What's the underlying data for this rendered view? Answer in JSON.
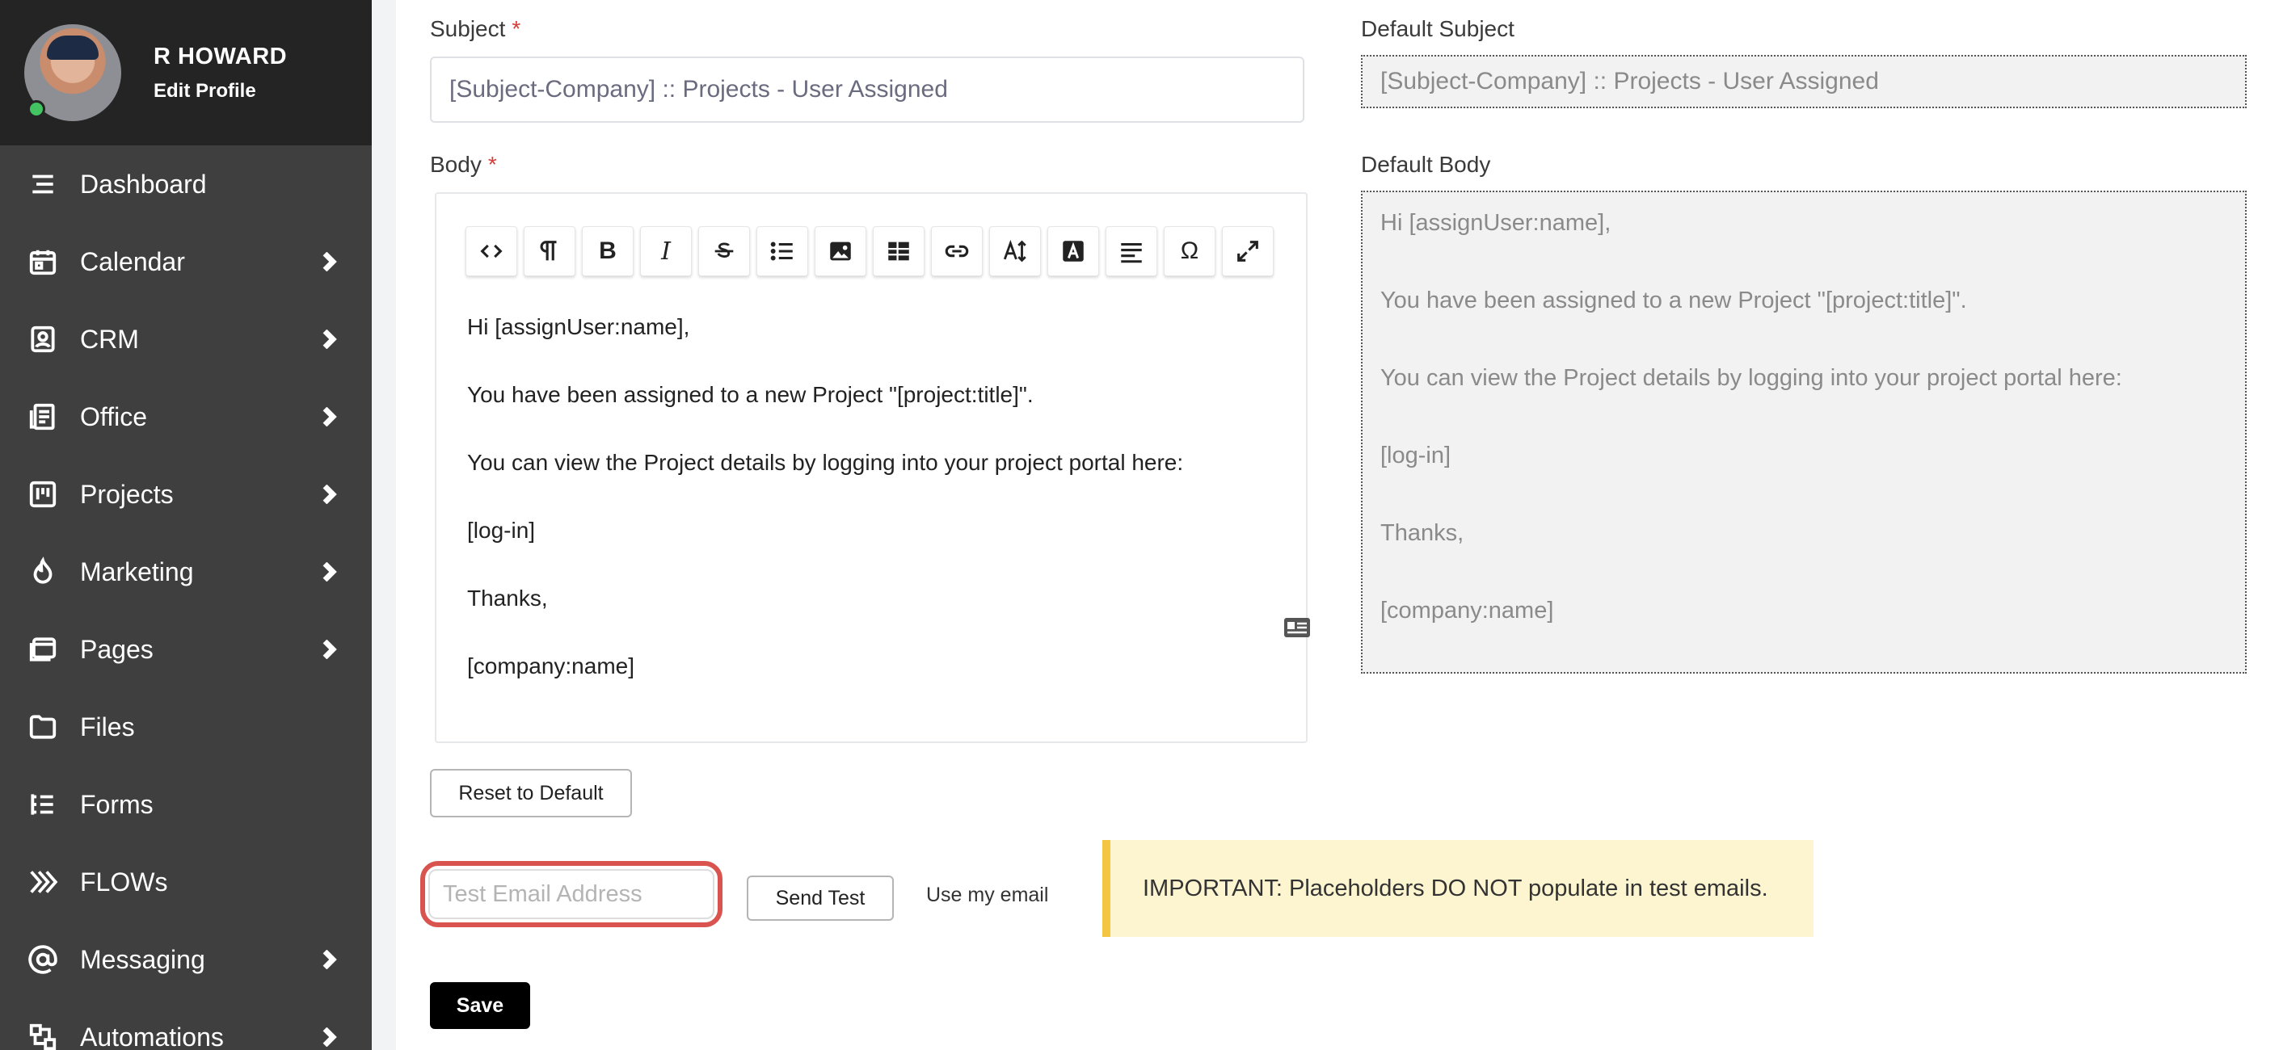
{
  "profile": {
    "name": "R HOWARD",
    "edit_label": "Edit Profile"
  },
  "nav": [
    {
      "label": "Dashboard",
      "icon": "menu-icon",
      "chevron": false
    },
    {
      "label": "Calendar",
      "icon": "calendar-icon",
      "chevron": true
    },
    {
      "label": "CRM",
      "icon": "contact-card-icon",
      "chevron": true
    },
    {
      "label": "Office",
      "icon": "office-document-icon",
      "chevron": true
    },
    {
      "label": "Projects",
      "icon": "kanban-icon",
      "chevron": true
    },
    {
      "label": "Marketing",
      "icon": "flame-icon",
      "chevron": true
    },
    {
      "label": "Pages",
      "icon": "browser-window-icon",
      "chevron": true
    },
    {
      "label": "Files",
      "icon": "folder-icon",
      "chevron": false
    },
    {
      "label": "Forms",
      "icon": "form-list-icon",
      "chevron": false
    },
    {
      "label": "FLOWs",
      "icon": "flow-arrows-icon",
      "chevron": false
    },
    {
      "label": "Messaging",
      "icon": "at-sign-icon",
      "chevron": true
    },
    {
      "label": "Automations",
      "icon": "automation-icon",
      "chevron": true
    }
  ],
  "form": {
    "subject_label": "Subject",
    "subject_value": "[Subject-Company] :: Projects - User Assigned",
    "default_subject_label": "Default Subject",
    "default_subject_value": "[Subject-Company] :: Projects - User Assigned",
    "body_label": "Body",
    "default_body_label": "Default Body",
    "required_mark": "*",
    "body_lines": [
      "Hi [assignUser:name],",
      "You have been assigned to a new Project \"[project:title]\".",
      "You can view the Project details by logging into your project portal here:",
      "[log-in]",
      "Thanks,",
      "[company:name]"
    ],
    "default_body_lines": [
      "Hi [assignUser:name],",
      "You have been assigned to a new Project \"[project:title]\".",
      "You can view the Project details by logging into your project portal here:",
      "[log-in]",
      "Thanks,",
      "[company:name]"
    ]
  },
  "toolbar": [
    "code-view-icon",
    "paragraph-icon",
    "bold-icon",
    "italic-icon",
    "strikethrough-icon",
    "bullet-list-icon",
    "image-icon",
    "table-icon",
    "link-icon",
    "font-size-icon",
    "text-color-icon",
    "align-icon",
    "special-character-icon",
    "fullscreen-icon"
  ],
  "actions": {
    "reset_label": "Reset to Default",
    "test_email_placeholder": "Test Email Address",
    "send_test_label": "Send Test",
    "use_my_email_label": "Use my email",
    "save_label": "Save"
  },
  "notice": {
    "text": "IMPORTANT: Placeholders DO NOT populate in test emails.",
    "accent_color": "#f4c542"
  },
  "colors": {
    "sidebar": "#3f3f3f",
    "profile_bar": "#242424",
    "required": "#d43f3a",
    "highlight_ring": "#d9544f"
  }
}
